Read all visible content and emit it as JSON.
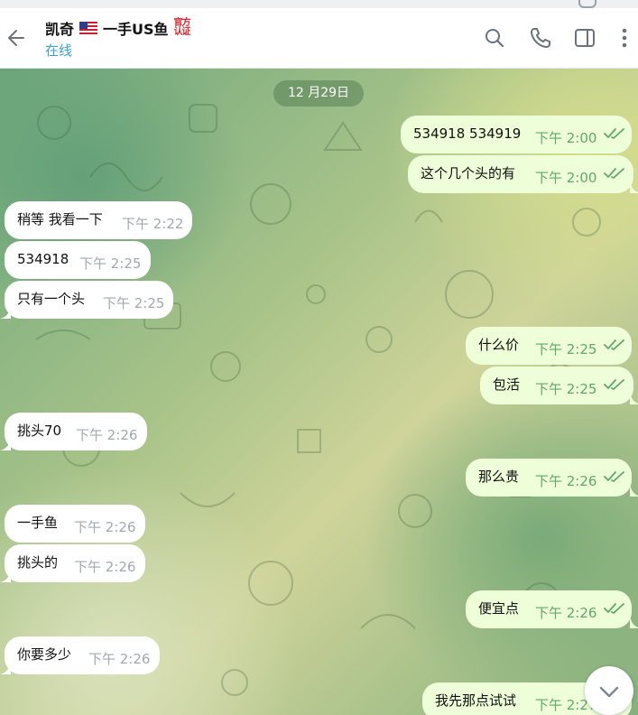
{
  "header": {
    "title_prefix": "凯奇",
    "title_suffix": "一手US鱼",
    "seal_line1": "官方",
    "seal_line2": "认证",
    "status": "在线"
  },
  "chat": {
    "date": "12 月29日",
    "messages": [
      {
        "dir": "out",
        "text": "534918   534919",
        "time": "下午 2:00",
        "read": true
      },
      {
        "dir": "out",
        "text": "这个几个头的有",
        "time": "下午 2:00",
        "read": true
      },
      {
        "dir": "in",
        "text": "稍等 我看一下",
        "time": "下午 2:22"
      },
      {
        "dir": "in",
        "text": "534918",
        "time": "下午 2:25"
      },
      {
        "dir": "in",
        "text": "只有一个头",
        "time": "下午 2:25"
      },
      {
        "dir": "out",
        "text": "什么价",
        "time": "下午 2:25",
        "read": true
      },
      {
        "dir": "out",
        "text": "包活",
        "time": "下午 2:25",
        "read": true
      },
      {
        "dir": "in",
        "text": "挑头70",
        "time": "下午 2:26"
      },
      {
        "dir": "out",
        "text": "那么贵",
        "time": "下午 2:26",
        "read": true
      },
      {
        "dir": "in",
        "text": "一手鱼",
        "time": "下午 2:26"
      },
      {
        "dir": "in",
        "text": "挑头的",
        "time": "下午 2:26"
      },
      {
        "dir": "out",
        "text": "便宜点",
        "time": "下午 2:26",
        "read": true
      },
      {
        "dir": "in",
        "text": "你要多少",
        "time": "下午 2:26"
      },
      {
        "dir": "out",
        "text": "我先那点试试",
        "time": "下午 2:27",
        "read": true
      }
    ]
  },
  "icons": {
    "back": "arrow-left-icon",
    "search": "search-icon",
    "call": "phone-icon",
    "panel": "side-panel-icon",
    "more": "more-vertical-icon",
    "scroll": "chevron-down-icon",
    "flag": "us-flag-icon"
  },
  "colors": {
    "accent": "#3aa0c9",
    "outgoing_bubble": "#eefed8",
    "incoming_bubble": "#ffffff",
    "read_ticks": "#5ea96a"
  }
}
